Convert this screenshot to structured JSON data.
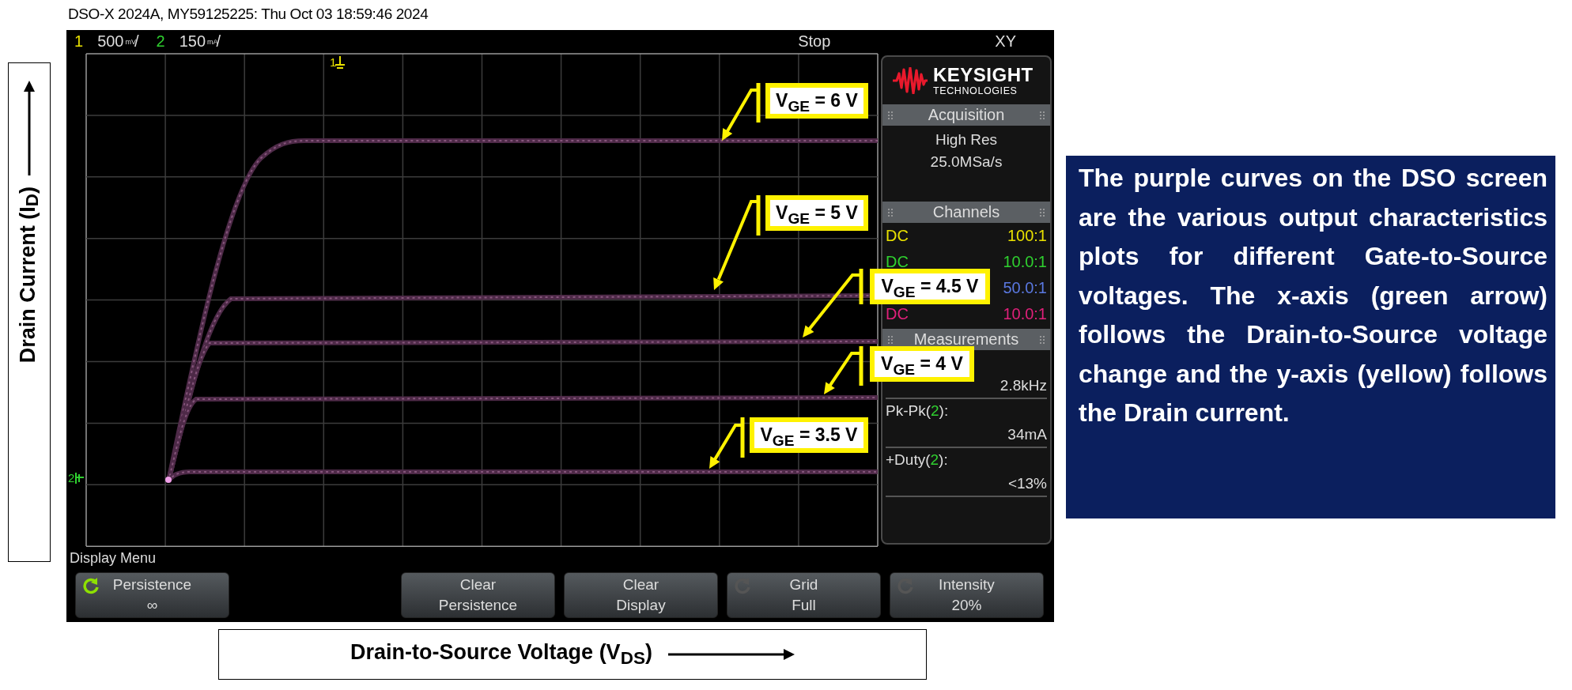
{
  "title_line": "DSO-X 2024A, MY59125225: Thu Oct 03 18:59:46 2024",
  "y_axis_label": "Drain Current (I$_{D}$)",
  "scope": {
    "status_bar": {
      "channels": [
        {
          "number": "1",
          "scale": "500",
          "unit": "mV",
          "suffix": "/",
          "color": "#e8e000"
        },
        {
          "number": "2",
          "scale": "150",
          "unit": "mA",
          "suffix": "/",
          "color": "#2fd02f"
        }
      ],
      "run_state": "Stop",
      "mode": "XY"
    },
    "markers": [
      {
        "label": "1",
        "color": "#e8e000"
      },
      {
        "label": "2",
        "color": "#2fd02f"
      }
    ],
    "callouts": [
      {
        "text": "V$_{GE}$ = 6 V"
      },
      {
        "text": "V$_{GE}$ = 5 V"
      },
      {
        "text": "V$_{GE}$ = 4.5 V"
      },
      {
        "text": "V$_{GE}$ = 4 V"
      },
      {
        "text": "V$_{GE}$ = 3.5 V"
      }
    ],
    "side_panel": {
      "logo": {
        "name": "KEYSIGHT",
        "sub": "TECHNOLOGIES"
      },
      "acquisition": {
        "title": "Acquisition",
        "mode": "High Res",
        "rate": "25.0MSa/s"
      },
      "channels": {
        "title": "Channels",
        "rows": [
          {
            "coupling": "DC",
            "probe": "100:1",
            "color": "#e8e000"
          },
          {
            "coupling": "DC",
            "probe": "10.0:1",
            "color": "#2fd02f"
          },
          {
            "probe": "50.0:1",
            "color": "#5a78e0"
          },
          {
            "coupling": "DC",
            "probe": "10.0:1",
            "color": "#e0207a"
          }
        ]
      },
      "measurements": {
        "title": "Measurements",
        "items": [
          {
            "value": "2.8kHz"
          },
          {
            "label_start": "Pk-Pk(",
            "source": "2",
            "label_end": "):",
            "value": "34mA"
          },
          {
            "label_start": "+Duty(",
            "source": "2",
            "label_end": "):",
            "value": "<13%"
          }
        ]
      }
    },
    "menu": {
      "title": "Display Menu",
      "softkeys": [
        {
          "kind": "knob",
          "title": "Persistence",
          "value": "∞",
          "selected": true
        },
        {
          "kind": "action",
          "title": "Clear",
          "value": "Persistence"
        },
        {
          "kind": "action",
          "title": "Clear",
          "value": "Display"
        },
        {
          "kind": "knob",
          "title": "Grid",
          "value": "Full",
          "selected": false
        },
        {
          "kind": "knob",
          "title": "Intensity",
          "value": "20%",
          "selected": false
        }
      ]
    }
  },
  "x_axis_label": "Drain-to-Source Voltage (V$_{DS}$)",
  "description": "The purple curves on the DSO screen are the various output characteristics plots for different Gate-to-Source voltages. The x-axis (green arrow) follows the Drain-to-Source voltage change and the y-axis (yellow) follows the Drain current."
}
